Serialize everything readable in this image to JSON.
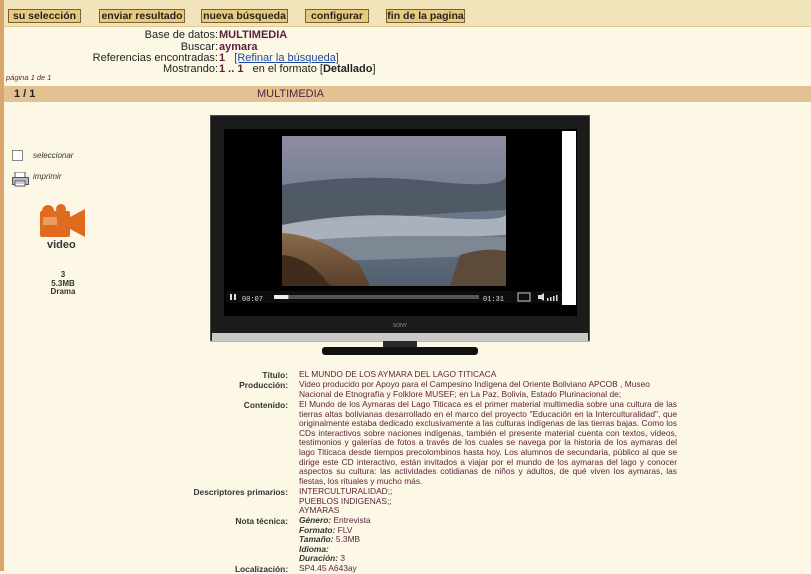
{
  "toolbar": {
    "buttons": [
      "su selección",
      "enviar resultado",
      "nueva búsqueda",
      "configurar",
      "fin de la pagina"
    ]
  },
  "summary": {
    "database_label": "Base de datos:",
    "database_value": "MULTIMEDIA",
    "search_label": "Buscar:",
    "search_value": "aymara",
    "refs_label": "Referencias encontradas:",
    "refs_count": "1",
    "refine_link": "[Refinar la búsqueda]",
    "showing_label": "Mostrando:",
    "showing_range": "1 .. 1",
    "showing_text": "en el formato",
    "format_open": "[",
    "format_value": "Detallado",
    "format_close": "]",
    "page_info": "página 1 de 1"
  },
  "record_bar": {
    "index": "1 / 1",
    "title": "MULTIMEDIA"
  },
  "sidebar": {
    "select_label": "seleccionar",
    "print_label": "imprimir",
    "video_label": "video",
    "item_count": "3",
    "item_size": "5.3MB",
    "item_genre": "Drama"
  },
  "player": {
    "time_current": "00:07",
    "time_total": "01:31",
    "brand": "SONY",
    "progress": 0.07
  },
  "details": {
    "titulo_label": "Título:",
    "titulo_value": "EL MUNDO DE LOS AYMARA DEL LAGO TITICACA",
    "produccion_label": "Producción:",
    "produccion_value": "Video producido por Apoyo para el Campesino Indígena del Oriente Boliviano APCOB , Museo Nacional de Etnografía y Folklore MUSEF; en La Paz, Bolivia, Estado Plurinacional de;",
    "contenido_label": "Contenido:",
    "contenido_value": "El Mundo de los Aymaras del Lago Titicaca es el primer material multimedia sobre una cultura de las tierras altas bolivianas desarrollado en el marco del proyecto \"Educación en la Interculturalidad\", que originalmente estaba dedicado exclusivamente a las culturas indígenas de las tierras bajas. Como los CDs interactivos sobre naciones indígenas, también el presente material cuenta con textos, videos, testimonios y galerías de fotos a través de los cuales se navega por la historia de los aymaras del lago Titicaca desde tiempos precolombinos hasta hoy. Los alumnos de secundaria, público al que se dirige este CD interactivo, están invitados a viajar por el mundo de los aymaras del lago y conocer aspectos su cultura: las actividades cotidianas de niños y adultos, de qué viven los aymaras, las fiestas, los rituales y mucho más.",
    "descriptores_label": "Descriptores primarios:",
    "descriptores": [
      "INTERCULTURALIDAD;;",
      "PUEBLOS INDIGENAS;;",
      "AYMARAS"
    ],
    "nota_label": "Nota técnica:",
    "nota": {
      "genero_label": "Género:",
      "genero_value": "Entrevista",
      "formato_label": "Formato:",
      "formato_value": "FLV",
      "tamano_label": "Tamaño:",
      "tamano_value": "5.3MB",
      "idioma_label": "Idioma:",
      "idioma_value": "",
      "duracion_label": "Duración:",
      "duracion_value": "3"
    },
    "localizacion_label": "Localización:",
    "localizacion_value": "SP4.45 A643ay"
  }
}
